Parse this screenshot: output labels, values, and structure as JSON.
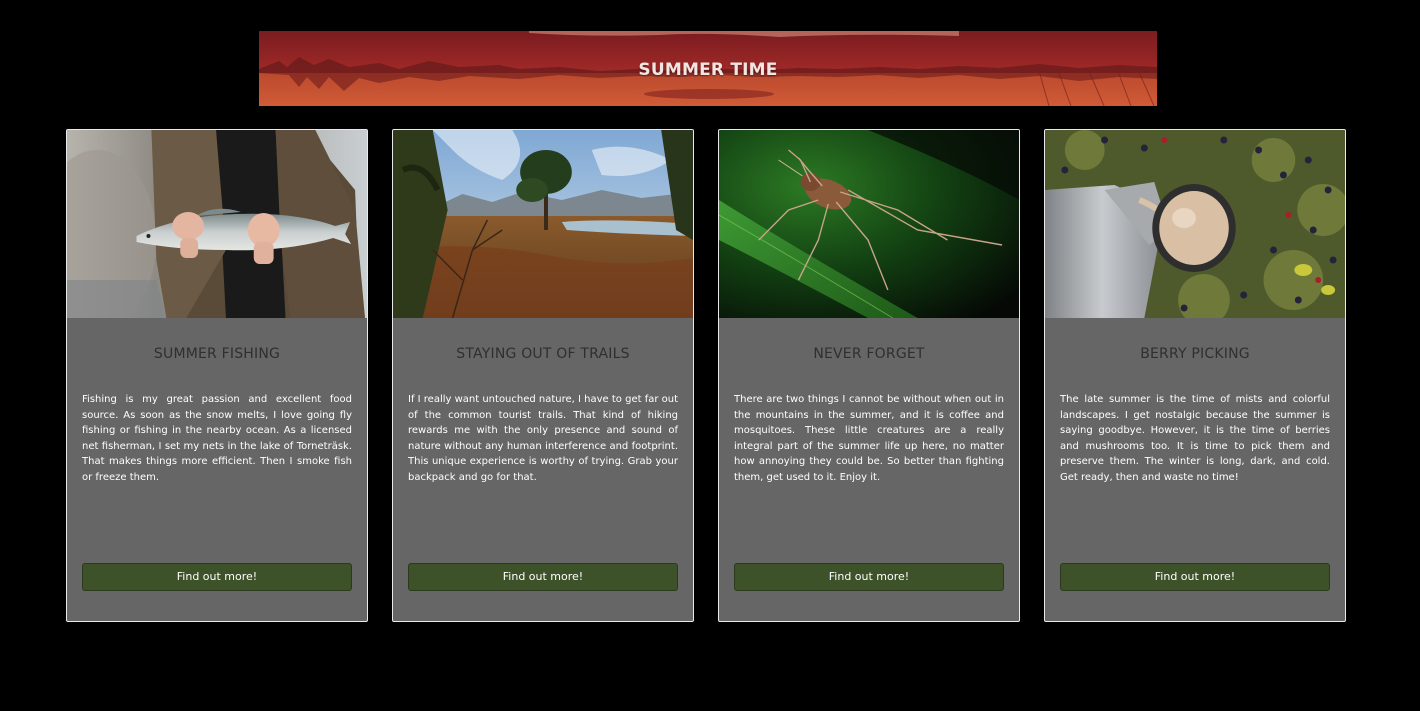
{
  "banner": {
    "title": "SUMMER TIME"
  },
  "cards": [
    {
      "title": "SUMMER FISHING",
      "text": "Fishing is my great passion and excellent food source. As soon as the snow melts, I love going fly fishing or fishing in the nearby ocean. As a licensed net fisherman, I set my nets in the lake of Torneträsk. That makes things more efficient. Then I smoke fish or freeze them.",
      "button": "Find out more!",
      "image": "person-holding-fish-photo"
    },
    {
      "title": "STAYING OUT OF TRAILS",
      "text": "If I really want untouched nature, I have to get far out of the common tourist trails. That kind of hiking rewards me with the only presence and sound of nature without any human interference and footprint. This unique experience is worthy of trying. Grab your backpack and go for that.",
      "button": "Find out more!",
      "image": "autumn-wilderness-landscape-photo"
    },
    {
      "title": "NEVER FORGET",
      "text": "There are two things I cannot be without when out in the mountains in the summer, and it is coffee and mosquitoes. These little creatures are a really integral part of the summer life up here, no matter how annoying they could be. So better than fighting them, get used to it. Enjoy it.",
      "button": "Find out more!",
      "image": "mosquito-on-grass-photo"
    },
    {
      "title": "BERRY PICKING",
      "text": "The late summer is the time of mists and colorful landscapes. I get nostalgic because the summer is saying goodbye. However, it is the time of berries and mushrooms too. It is time to pick them and preserve them. The winter is long, dark, and cold. Get ready, then and waste no time!",
      "button": "Find out more!",
      "image": "thermos-pouring-coffee-on-berries-photo"
    }
  ]
}
